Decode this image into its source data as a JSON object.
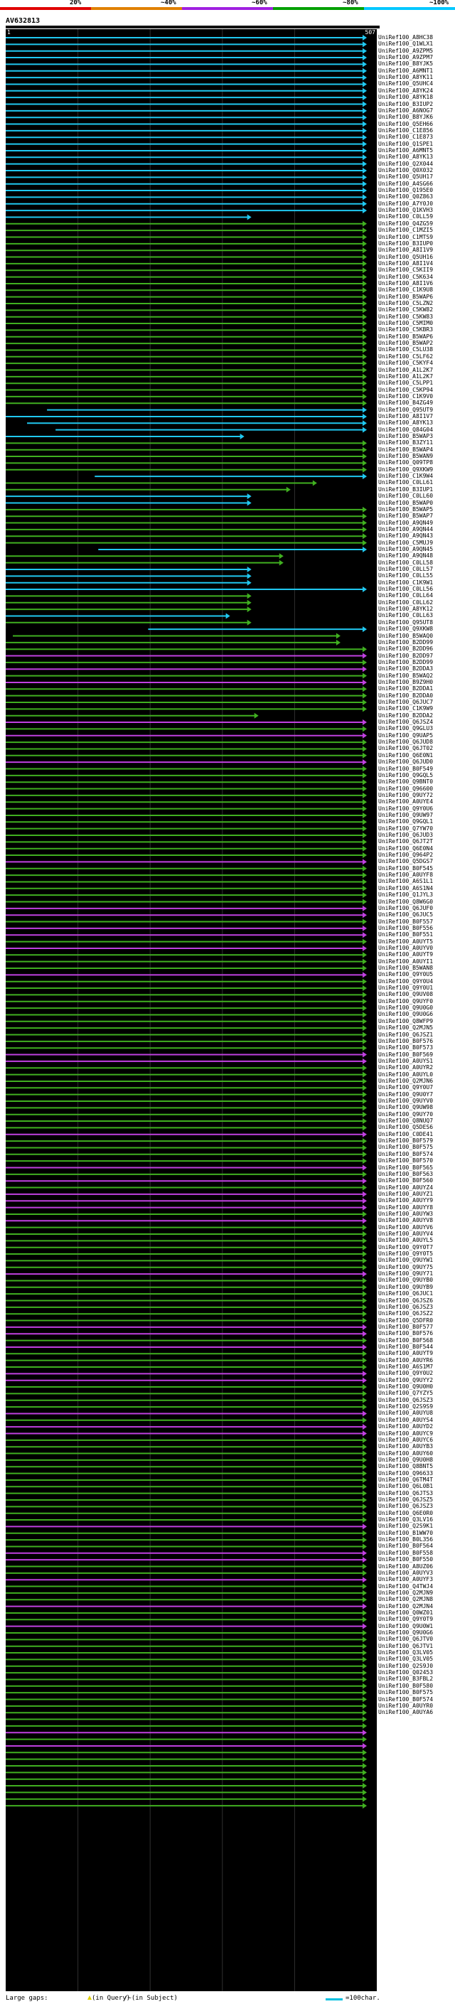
{
  "scale": {
    "labels": [
      {
        "text": "20%",
        "at": 0.2
      },
      {
        "text": "~40%",
        "at": 0.4
      },
      {
        "text": "~60%",
        "at": 0.6
      },
      {
        "text": "~80%",
        "at": 0.8
      },
      {
        "text": "~100%",
        "at": 1.0
      }
    ],
    "colors": [
      "#e00000",
      "#e08000",
      "#a020e0",
      "#00a000",
      "#00c8ff"
    ]
  },
  "query": {
    "name": "AV632813",
    "start": "1",
    "end": "507"
  },
  "colors": {
    "20": "#e00000",
    "40": "#e08000",
    "60": "#c040e0",
    "80": "#40b020",
    "100": "#20c8f0"
  },
  "ids": [
    "UniRef100_A8HC38",
    "UniRef100_Q1WLX1",
    "UniRef100_A9ZPM5",
    "UniRef100_A9ZPM7",
    "UniRef100_B8YJK5",
    "UniRef100_A6MNT1",
    "UniRef100_A8YK11",
    "UniRef100_Q5UHC4",
    "UniRef100_A8YK24",
    "UniRef100_A8YK18",
    "UniRef100_B3IUP2",
    "UniRef100_A6NOG7",
    "UniRef100_B8YJK6",
    "UniRef100_Q5EH66",
    "UniRef100_C1E856",
    "UniRef100_C1E873",
    "UniRef100_Q1SPE1",
    "UniRef100_A6MNT5",
    "UniRef100_A8YK13",
    "UniRef100_Q2X044",
    "UniRef100_Q0X032",
    "UniRef100_Q5UH17",
    "UniRef100_A4SG66",
    "UniRef100_Q195E0",
    "UniRef100_Q0Z863",
    "UniRef100_A7Y0J0",
    "UniRef100_Q1KVH3",
    "UniRef100_C0LL59",
    "UniRef100_Q4ZG59",
    "UniRef100_C1MZI5",
    "UniRef100_C1MTS9",
    "UniRef100_B3IUP0",
    "UniRef100_A8I1V9",
    "UniRef100_Q5UH16",
    "UniRef100_A8I1V4",
    "UniRef100_C5KII9",
    "UniRef100_C5K634",
    "UniRef100_A8I1V6",
    "UniRef100_C1K9U8",
    "UniRef100_B5WAP6",
    "UniRef100_C5LZN2",
    "UniRef100_C5KW82",
    "UniRef100_C5KW83",
    "UniRef100_C5MIM0",
    "UniRef100_C5KBR3",
    "UniRef100_B5WAP6",
    "UniRef100_B5WAP2",
    "UniRef100_C5LU38",
    "UniRef100_C5LF62",
    "UniRef100_C5KYF4",
    "UniRef100_A1L2K7",
    "UniRef100_A1L2K7",
    "UniRef100_C5LPP1",
    "UniRef100_C5KP94",
    "UniRef100_C1K9V0",
    "UniRef100_B4ZG49",
    "UniRef100_Q95UT9",
    "UniRef100_A8I1V7",
    "UniRef100_A8YK13",
    "UniRef100_Q84G04",
    "UniRef100_B5WAP3",
    "UniRef100_B3ZY11",
    "UniRef100_B5WAP4",
    "UniRef100_B5WAN9",
    "UniRef100_Q09TP8",
    "UniRef100_Q9XKW9",
    "UniRef100_C1K9W4",
    "UniRef100_C0LL61",
    "UniRef100_B3IUP1",
    "UniRef100_C0LL60",
    "UniRef100_B5WAP0",
    "UniRef100_B5WAP5",
    "UniRef100_B5WAP7",
    "UniRef100_A9QN49",
    "UniRef100_A9QN44",
    "UniRef100_A9QN43",
    "UniRef100_C5MUJ9",
    "UniRef100_A9QN45",
    "UniRef100_A9QN48",
    "UniRef100_C0LL58",
    "UniRef100_C0LL57",
    "UniRef100_C0LL55",
    "UniRef100_C1K9W1",
    "UniRef100_C0LL56",
    "UniRef100_C0LL64",
    "UniRef100_C0LL62",
    "UniRef100_A8YK12",
    "UniRef100_C0LL63",
    "UniRef100_Q95UT8",
    "UniRef100_Q9XKW8",
    "UniRef100_B5WAQ0",
    "UniRef100_B2DD99",
    "UniRef100_B2DD96",
    "UniRef100_B2DD97",
    "UniRef100_B2DD99",
    "UniRef100_B2DDA3",
    "UniRef100_B5WAQ2",
    "UniRef100_B9Z9H0",
    "UniRef100_B2DDA1",
    "UniRef100_B2DDA0",
    "UniRef100_Q6JUC7",
    "UniRef100_C1K9W9",
    "UniRef100_B2DDA2",
    "UniRef100_Q6JSZ4",
    "UniRef100_Q9GLU3",
    "UniRef100_Q9UAP5",
    "UniRef100_Q6JUD8",
    "UniRef100_Q6JT02",
    "UniRef100_Q6E0N1",
    "UniRef100_Q6JUD0",
    "UniRef100_B0F549",
    "UniRef100_Q9GQL5",
    "UniRef100_Q9BNT0",
    "UniRef100_Q96600",
    "UniRef100_Q9UY72",
    "UniRef100_A0UYE4",
    "UniRef100_Q9Y0U6",
    "UniRef100_Q9UW97",
    "UniRef100_Q9GQL1",
    "UniRef100_Q7YW70",
    "UniRef100_Q6JUD3",
    "UniRef100_Q6JT2T",
    "UniRef100_Q6E0N4",
    "UniRef100_Q964P2",
    "UniRef100_Q5DGS7",
    "UniRef100_B0F545",
    "UniRef100_A0UYF8",
    "UniRef100_A6S1L1",
    "UniRef100_A6S1N4",
    "UniRef100_Q1JYL3",
    "UniRef100_Q8W6G0",
    "UniRef100_Q6JUF0",
    "UniRef100_Q6JUC5",
    "UniRef100_B0F557",
    "UniRef100_B0F556",
    "UniRef100_B0F551",
    "UniRef100_A0UYT5",
    "UniRef100_A0UYV0",
    "UniRef100_A0UYT9",
    "UniRef100_A0UYI1",
    "UniRef100_B5WAN8",
    "UniRef100_Q9Y0U5",
    "UniRef100_Q9Y0U4",
    "UniRef100_Q9Y0U1",
    "UniRef100_Q9UV08",
    "UniRef100_Q9UYF0",
    "UniRef100_Q9U0G0",
    "UniRef100_Q9U0G6",
    "UniRef100_Q8WFP9",
    "UniRef100_Q2MJN5",
    "UniRef100_Q6JSZ1",
    "UniRef100_B0F576",
    "UniRef100_B0F573",
    "UniRef100_B0F569",
    "UniRef100_A0UYS1",
    "UniRef100_A0UYR2",
    "UniRef100_A0UYL0",
    "UniRef100_Q2MJN6",
    "UniRef100_Q9Y0U7",
    "UniRef100_Q9U0Y7",
    "UniRef100_Q9UYV0",
    "UniRef100_Q9UW98",
    "UniRef100_Q9UY70",
    "UniRef100_Q8NUQ7",
    "UniRef100_Q5DES6",
    "UniRef100_C0DE41",
    "UniRef100_B0F579",
    "UniRef100_B0F575",
    "UniRef100_B0F574",
    "UniRef100_B0F570",
    "UniRef100_B0F565",
    "UniRef100_B0F563",
    "UniRef100_B0F560",
    "UniRef100_A0UYZ4",
    "UniRef100_A0UYZ1",
    "UniRef100_A0UYY9",
    "UniRef100_A0UYY8",
    "UniRef100_A0UYW3",
    "UniRef100_A0UYV8",
    "UniRef100_A0UYV6",
    "UniRef100_A0UYV4",
    "UniRef100_A0UYL5",
    "UniRef100_Q9Y0T7",
    "UniRef100_Q9Y0T5",
    "UniRef100_Q9UYW1",
    "UniRef100_Q9UY75",
    "UniRef100_Q9UY71",
    "UniRef100_Q9UYB0",
    "UniRef100_Q9UYB9",
    "UniRef100_Q6JUC1",
    "UniRef100_Q6JSZ6",
    "UniRef100_Q6JSZ3",
    "UniRef100_Q6JSZ2",
    "UniRef100_Q5DFR0",
    "UniRef100_B0F577",
    "UniRef100_B0F576",
    "UniRef100_B0F568",
    "UniRef100_B0F544",
    "UniRef100_A0UYT9",
    "UniRef100_A0UYR6",
    "UniRef100_A6S1M7",
    "UniRef100_Q9Y0U2",
    "UniRef100_Q9UYY2",
    "UniRef100_Q9U0H0",
    "UniRef100_Q7YZY5",
    "UniRef100_Q6JSZ3",
    "UniRef100_Q2S9S9",
    "UniRef100_A0UYU8",
    "UniRef100_A0UYS4",
    "UniRef100_A0UYD2",
    "UniRef100_A0UYC9",
    "UniRef100_A0UYC6",
    "UniRef100_A0UYB3",
    "UniRef100_A0UY60",
    "UniRef100_Q9U0H8",
    "UniRef100_Q8BNT5",
    "UniRef100_Q96633",
    "UniRef100_Q6TM4T",
    "UniRef100_Q6L0B1",
    "UniRef100_Q6JTS3",
    "UniRef100_Q6JSZ5",
    "UniRef100_Q6JSZ3",
    "UniRef100_Q6E0R0",
    "UniRef100_Q3LV16",
    "UniRef100_Q2S9K1",
    "UniRef100_B1WW70",
    "UniRef100_B0L356",
    "UniRef100_B0F564",
    "UniRef100_B0F558",
    "UniRef100_B0F550",
    "UniRef100_A8UZ06",
    "UniRef100_A0UYV3",
    "UniRef100_A0UYF3",
    "UniRef100_Q4TWJ4",
    "UniRef100_Q2MJN9",
    "UniRef100_Q2MJN8",
    "UniRef100_Q2MJN4",
    "UniRef100_Q0WZ01",
    "UniRef100_Q9Y0T9",
    "UniRef100_Q9U0W1",
    "UniRef100_Q9U0G6",
    "UniRef100_Q6JTV0",
    "UniRef100_Q6JTV1",
    "UniRef100_Q3LV05",
    "UniRef100_Q3LV05",
    "UniRef100_Q2S9J0",
    "UniRef100_Q02453",
    "UniRef100_B3FBL2",
    "UniRef100_B0F580",
    "UniRef100_B0F575",
    "UniRef100_B0F574",
    "UniRef100_A0UYR0",
    "UniRef100_A0UYA6"
  ],
  "rows": [
    [
      0,
      507,
      "100"
    ],
    [
      0,
      507,
      "100"
    ],
    [
      0,
      507,
      "100"
    ],
    [
      0,
      507,
      "100"
    ],
    [
      0,
      507,
      "100"
    ],
    [
      0,
      507,
      "100"
    ],
    [
      0,
      507,
      "100"
    ],
    [
      0,
      507,
      "100"
    ],
    [
      0,
      507,
      "100"
    ],
    [
      0,
      507,
      "100"
    ],
    [
      0,
      507,
      "100"
    ],
    [
      0,
      507,
      "100"
    ],
    [
      0,
      507,
      "100"
    ],
    [
      0,
      507,
      "100"
    ],
    [
      0,
      507,
      "100"
    ],
    [
      0,
      507,
      "100"
    ],
    [
      0,
      507,
      "100"
    ],
    [
      0,
      507,
      "100"
    ],
    [
      0,
      507,
      "100"
    ],
    [
      0,
      507,
      "100"
    ],
    [
      0,
      507,
      "100"
    ],
    [
      0,
      507,
      "100"
    ],
    [
      0,
      507,
      "100"
    ],
    [
      0,
      507,
      "100"
    ],
    [
      0,
      507,
      "100"
    ],
    [
      0,
      507,
      "100"
    ],
    [
      0,
      507,
      "100"
    ],
    [
      0,
      345,
      "100"
    ],
    [
      0,
      507,
      "80"
    ],
    [
      0,
      507,
      "80"
    ],
    [
      0,
      507,
      "80"
    ],
    [
      0,
      507,
      "80"
    ],
    [
      0,
      507,
      "80"
    ],
    [
      0,
      507,
      "80"
    ],
    [
      0,
      507,
      "80"
    ],
    [
      0,
      507,
      "80"
    ],
    [
      0,
      507,
      "80"
    ],
    [
      0,
      507,
      "80"
    ],
    [
      0,
      507,
      "80"
    ],
    [
      0,
      507,
      "80"
    ],
    [
      0,
      507,
      "80"
    ],
    [
      0,
      507,
      "80"
    ],
    [
      0,
      507,
      "80"
    ],
    [
      0,
      507,
      "80"
    ],
    [
      0,
      507,
      "80"
    ],
    [
      0,
      507,
      "80"
    ],
    [
      0,
      507,
      "80"
    ],
    [
      0,
      507,
      "80"
    ],
    [
      0,
      507,
      "80"
    ],
    [
      0,
      507,
      "80"
    ],
    [
      0,
      507,
      "80"
    ],
    [
      0,
      507,
      "80"
    ],
    [
      0,
      507,
      "80"
    ],
    [
      0,
      507,
      "80"
    ],
    [
      0,
      507,
      "80"
    ],
    [
      0,
      507,
      "80"
    ],
    [
      58,
      507,
      "100"
    ],
    [
      0,
      507,
      "100"
    ],
    [
      30,
      507,
      "100"
    ],
    [
      70,
      507,
      "100"
    ],
    [
      0,
      335,
      "100"
    ],
    [
      0,
      507,
      "80"
    ],
    [
      0,
      507,
      "80"
    ],
    [
      0,
      507,
      "80"
    ],
    [
      0,
      507,
      "80"
    ],
    [
      0,
      507,
      "80"
    ],
    [
      125,
      507,
      "100"
    ],
    [
      0,
      437,
      "80"
    ],
    [
      0,
      400,
      "80"
    ],
    [
      0,
      345,
      "100"
    ],
    [
      0,
      345,
      "100"
    ],
    [
      0,
      507,
      "80"
    ],
    [
      0,
      507,
      "80"
    ],
    [
      0,
      507,
      "80"
    ],
    [
      0,
      507,
      "80"
    ],
    [
      0,
      507,
      "80"
    ],
    [
      0,
      507,
      "80"
    ],
    [
      130,
      507,
      "100"
    ],
    [
      0,
      390,
      "80"
    ],
    [
      0,
      390,
      "80"
    ],
    [
      0,
      345,
      "100"
    ],
    [
      0,
      345,
      "100"
    ],
    [
      0,
      345,
      "100"
    ],
    [
      0,
      507,
      "100"
    ],
    [
      0,
      345,
      "80"
    ],
    [
      0,
      345,
      "80"
    ],
    [
      0,
      345,
      "80"
    ],
    [
      0,
      315,
      "100"
    ],
    [
      0,
      345,
      "80"
    ],
    [
      200,
      507,
      "100"
    ],
    [
      10,
      470,
      "80"
    ],
    [
      0,
      470,
      "80"
    ],
    [
      0,
      507,
      "80"
    ],
    [
      0,
      507,
      "60"
    ],
    [
      0,
      507,
      "80"
    ],
    [
      0,
      507,
      "60"
    ],
    [
      0,
      507,
      "80"
    ],
    [
      0,
      507,
      "60"
    ],
    [
      0,
      507,
      "80"
    ],
    [
      0,
      507,
      "80"
    ],
    [
      0,
      507,
      "80"
    ],
    [
      0,
      507,
      "80"
    ],
    [
      0,
      355,
      "80"
    ],
    [
      0,
      507,
      "60"
    ],
    [
      0,
      507,
      "80"
    ],
    [
      0,
      507,
      "60"
    ],
    [
      0,
      507,
      "80"
    ],
    [
      0,
      507,
      "80"
    ],
    [
      0,
      507,
      "80"
    ],
    [
      0,
      507,
      "60"
    ],
    [
      0,
      507,
      "80"
    ],
    [
      0,
      507,
      "80"
    ],
    [
      0,
      507,
      "80"
    ],
    [
      0,
      507,
      "80"
    ],
    [
      0,
      507,
      "80"
    ],
    [
      0,
      507,
      "80"
    ],
    [
      0,
      507,
      "80"
    ],
    [
      0,
      507,
      "80"
    ],
    [
      0,
      507,
      "80"
    ],
    [
      0,
      507,
      "80"
    ],
    [
      0,
      507,
      "80"
    ],
    [
      0,
      507,
      "80"
    ],
    [
      0,
      507,
      "80"
    ],
    [
      0,
      507,
      "80"
    ],
    [
      0,
      507,
      "60"
    ],
    [
      0,
      507,
      "80"
    ],
    [
      0,
      507,
      "80"
    ],
    [
      0,
      507,
      "80"
    ],
    [
      0,
      507,
      "80"
    ],
    [
      0,
      507,
      "80"
    ],
    [
      0,
      507,
      "80"
    ],
    [
      0,
      507,
      "60"
    ],
    [
      0,
      507,
      "60"
    ],
    [
      0,
      507,
      "80"
    ],
    [
      0,
      507,
      "60"
    ],
    [
      0,
      507,
      "60"
    ],
    [
      0,
      507,
      "80"
    ],
    [
      0,
      507,
      "60"
    ],
    [
      0,
      507,
      "80"
    ],
    [
      0,
      507,
      "80"
    ],
    [
      0,
      507,
      "80"
    ],
    [
      0,
      507,
      "60"
    ],
    [
      0,
      507,
      "80"
    ],
    [
      0,
      507,
      "80"
    ],
    [
      0,
      507,
      "80"
    ],
    [
      0,
      507,
      "80"
    ],
    [
      0,
      507,
      "80"
    ],
    [
      0,
      507,
      "80"
    ],
    [
      0,
      507,
      "80"
    ],
    [
      0,
      507,
      "80"
    ],
    [
      0,
      507,
      "80"
    ],
    [
      0,
      507,
      "80"
    ],
    [
      0,
      507,
      "80"
    ],
    [
      0,
      507,
      "60"
    ],
    [
      0,
      507,
      "60"
    ],
    [
      0,
      507,
      "80"
    ],
    [
      0,
      507,
      "80"
    ],
    [
      0,
      507,
      "80"
    ],
    [
      0,
      507,
      "80"
    ],
    [
      0,
      507,
      "80"
    ],
    [
      0,
      507,
      "80"
    ],
    [
      0,
      507,
      "80"
    ],
    [
      0,
      507,
      "80"
    ],
    [
      0,
      507,
      "80"
    ],
    [
      0,
      507,
      "80"
    ],
    [
      0,
      507,
      "60"
    ],
    [
      0,
      507,
      "80"
    ],
    [
      0,
      507,
      "80"
    ],
    [
      0,
      507,
      "80"
    ],
    [
      0,
      507,
      "80"
    ],
    [
      0,
      507,
      "60"
    ],
    [
      0,
      507,
      "80"
    ],
    [
      0,
      507,
      "60"
    ],
    [
      0,
      507,
      "80"
    ],
    [
      0,
      507,
      "60"
    ],
    [
      0,
      507,
      "60"
    ],
    [
      0,
      507,
      "60"
    ],
    [
      0,
      507,
      "80"
    ],
    [
      0,
      507,
      "60"
    ],
    [
      0,
      507,
      "80"
    ],
    [
      0,
      507,
      "80"
    ],
    [
      0,
      507,
      "80"
    ],
    [
      0,
      507,
      "80"
    ],
    [
      0,
      507,
      "80"
    ],
    [
      0,
      507,
      "80"
    ],
    [
      0,
      507,
      "80"
    ],
    [
      0,
      507,
      "60"
    ],
    [
      0,
      507,
      "80"
    ],
    [
      0,
      507,
      "80"
    ],
    [
      0,
      507,
      "80"
    ],
    [
      0,
      507,
      "80"
    ],
    [
      0,
      507,
      "80"
    ],
    [
      0,
      507,
      "80"
    ],
    [
      0,
      507,
      "80"
    ],
    [
      0,
      507,
      "60"
    ],
    [
      0,
      507,
      "60"
    ],
    [
      0,
      507,
      "80"
    ],
    [
      0,
      507,
      "60"
    ],
    [
      0,
      507,
      "80"
    ],
    [
      0,
      507,
      "80"
    ],
    [
      0,
      507,
      "80"
    ],
    [
      0,
      507,
      "60"
    ],
    [
      0,
      507,
      "60"
    ],
    [
      0,
      507,
      "80"
    ],
    [
      0,
      507,
      "80"
    ],
    [
      0,
      507,
      "80"
    ],
    [
      0,
      507,
      "80"
    ],
    [
      0,
      507,
      "60"
    ],
    [
      0,
      507,
      "80"
    ],
    [
      0,
      507,
      "60"
    ],
    [
      0,
      507,
      "60"
    ],
    [
      0,
      507,
      "80"
    ],
    [
      0,
      507,
      "80"
    ],
    [
      0,
      507,
      "80"
    ],
    [
      0,
      507,
      "80"
    ],
    [
      0,
      507,
      "80"
    ],
    [
      0,
      507,
      "80"
    ],
    [
      0,
      507,
      "80"
    ],
    [
      0,
      507,
      "80"
    ],
    [
      0,
      507,
      "80"
    ],
    [
      0,
      507,
      "80"
    ],
    [
      0,
      507,
      "80"
    ],
    [
      0,
      507,
      "80"
    ],
    [
      0,
      507,
      "80"
    ],
    [
      0,
      507,
      "60"
    ],
    [
      0,
      507,
      "80"
    ],
    [
      0,
      507,
      "80"
    ],
    [
      0,
      507,
      "80"
    ],
    [
      0,
      507,
      "60"
    ],
    [
      0,
      507,
      "60"
    ],
    [
      0,
      507,
      "80"
    ],
    [
      0,
      507,
      "80"
    ],
    [
      0,
      507,
      "60"
    ],
    [
      0,
      507,
      "80"
    ],
    [
      0,
      507,
      "80"
    ],
    [
      0,
      507,
      "80"
    ],
    [
      0,
      507,
      "60"
    ],
    [
      0,
      507,
      "80"
    ],
    [
      0,
      507,
      "80"
    ],
    [
      0,
      507,
      "60"
    ],
    [
      0,
      507,
      "80"
    ],
    [
      0,
      507,
      "80"
    ],
    [
      0,
      507,
      "80"
    ],
    [
      0,
      507,
      "80"
    ],
    [
      0,
      507,
      "80"
    ],
    [
      0,
      507,
      "80"
    ],
    [
      0,
      507,
      "80"
    ],
    [
      0,
      507,
      "80"
    ],
    [
      0,
      507,
      "80"
    ],
    [
      0,
      507,
      "80"
    ],
    [
      0,
      507,
      "80"
    ],
    [
      0,
      507,
      "80"
    ],
    [
      0,
      507,
      "80"
    ],
    [
      0,
      507,
      "80"
    ],
    [
      0,
      507,
      "80"
    ],
    [
      0,
      507,
      "60"
    ],
    [
      0,
      507,
      "80"
    ],
    [
      0,
      507,
      "60"
    ],
    [
      0,
      507,
      "80"
    ],
    [
      0,
      507,
      "80"
    ],
    [
      0,
      507,
      "80"
    ],
    [
      0,
      507,
      "80"
    ],
    [
      0,
      507,
      "80"
    ],
    [
      0,
      507,
      "80"
    ],
    [
      0,
      507,
      "80"
    ],
    [
      0,
      507,
      "80"
    ],
    [
      0,
      507,
      "80"
    ]
  ],
  "legend": {
    "gaps_label": "Large gaps:",
    "in_query": "(in Query)",
    "in_subject": "/~(in Subject)",
    "scale_label": "=100char."
  }
}
